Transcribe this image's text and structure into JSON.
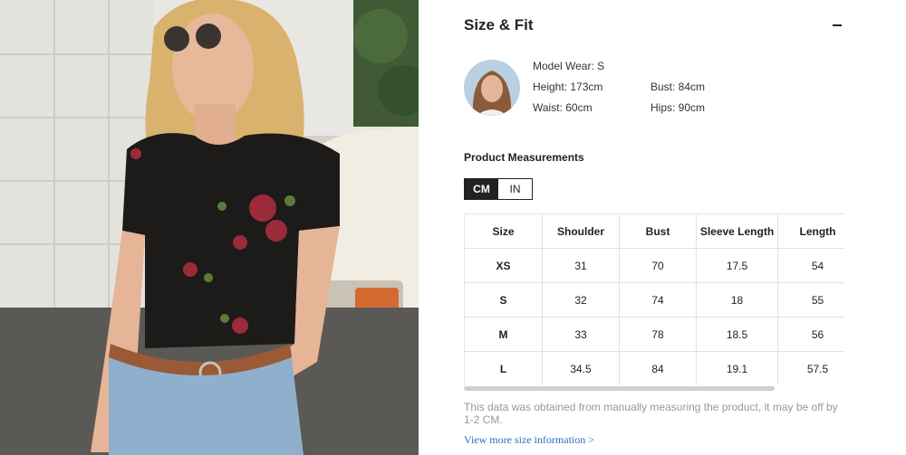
{
  "section": {
    "title": "Size & Fit",
    "collapse_icon": "minus-icon"
  },
  "model": {
    "wear": "Model Wear: S",
    "height": "Height: 173cm",
    "bust": "Bust: 84cm",
    "waist": "Waist: 60cm",
    "hips": "Hips: 90cm"
  },
  "measurements": {
    "title": "Product Measurements",
    "units": [
      "CM",
      "IN"
    ],
    "active_unit": "CM",
    "headers": [
      "Size",
      "Shoulder",
      "Bust",
      "Sleeve Length",
      "Length"
    ],
    "rows": [
      [
        "XS",
        "31",
        "70",
        "17.5",
        "54"
      ],
      [
        "S",
        "32",
        "74",
        "18",
        "55"
      ],
      [
        "M",
        "33",
        "78",
        "18.5",
        "56"
      ],
      [
        "L",
        "34.5",
        "84",
        "19.1",
        "57.5"
      ]
    ]
  },
  "note": "This data was obtained from manually measuring the product, it may be off by 1-2 CM.",
  "more_link": "View more size information >",
  "colors": {
    "text": "#222222",
    "muted": "#999999",
    "link": "#2b6fc0",
    "border": "#e2e2e2"
  }
}
